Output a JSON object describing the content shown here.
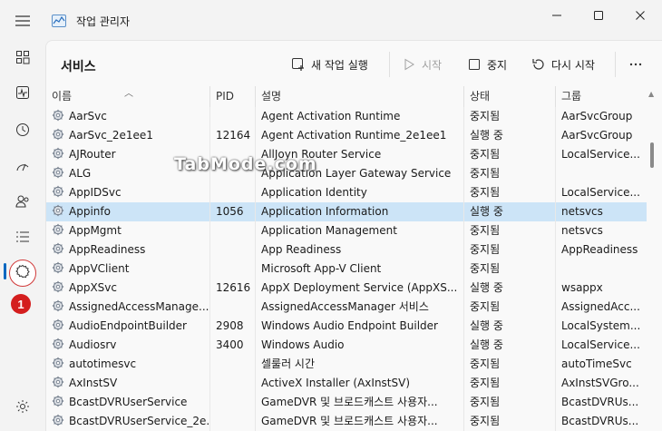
{
  "window": {
    "title": "작업 관리자"
  },
  "sidebar": {
    "items": [
      {
        "icon": "processes-icon"
      },
      {
        "icon": "performance-icon"
      },
      {
        "icon": "app-history-icon"
      },
      {
        "icon": "startup-apps-icon"
      },
      {
        "icon": "users-icon"
      },
      {
        "icon": "details-icon"
      },
      {
        "icon": "services-icon"
      }
    ],
    "badge": "1",
    "settings_icon": "settings-icon"
  },
  "header": {
    "title": "서비스",
    "new_task": "새 작업 실행",
    "start": "시작",
    "stop": "중지",
    "restart": "다시 시작"
  },
  "table": {
    "columns": {
      "name": "이름",
      "pid": "PID",
      "desc": "설명",
      "status": "상태",
      "group": "그룹"
    },
    "rows": [
      {
        "name": "AarSvc",
        "pid": "",
        "desc": "Agent Activation Runtime",
        "status": "중지됨",
        "group": "AarSvcGroup"
      },
      {
        "name": "AarSvc_2e1ee1",
        "pid": "12164",
        "desc": "Agent Activation Runtime_2e1ee1",
        "status": "실행 중",
        "group": "AarSvcGroup"
      },
      {
        "name": "AJRouter",
        "pid": "",
        "desc": "AllJoyn Router Service",
        "status": "중지됨",
        "group": "LocalService..."
      },
      {
        "name": "ALG",
        "pid": "",
        "desc": "Application Layer Gateway Service",
        "status": "중지됨",
        "group": ""
      },
      {
        "name": "AppIDSvc",
        "pid": "",
        "desc": "Application Identity",
        "status": "중지됨",
        "group": "LocalService..."
      },
      {
        "name": "Appinfo",
        "pid": "1056",
        "desc": "Application Information",
        "status": "실행 중",
        "group": "netsvcs"
      },
      {
        "name": "AppMgmt",
        "pid": "",
        "desc": "Application Management",
        "status": "중지됨",
        "group": "netsvcs"
      },
      {
        "name": "AppReadiness",
        "pid": "",
        "desc": "App Readiness",
        "status": "중지됨",
        "group": "AppReadiness"
      },
      {
        "name": "AppVClient",
        "pid": "",
        "desc": "Microsoft App-V Client",
        "status": "중지됨",
        "group": ""
      },
      {
        "name": "AppXSvc",
        "pid": "12616",
        "desc": "AppX Deployment Service (AppXS...",
        "status": "실행 중",
        "group": "wsappx"
      },
      {
        "name": "AssignedAccessManage...",
        "pid": "",
        "desc": "AssignedAccessManager 서비스",
        "status": "중지됨",
        "group": "AssignedAcc..."
      },
      {
        "name": "AudioEndpointBuilder",
        "pid": "2908",
        "desc": "Windows Audio Endpoint Builder",
        "status": "실행 중",
        "group": "LocalSystem..."
      },
      {
        "name": "Audiosrv",
        "pid": "3400",
        "desc": "Windows Audio",
        "status": "실행 중",
        "group": "LocalService..."
      },
      {
        "name": "autotimesvc",
        "pid": "",
        "desc": "셀룰러 시간",
        "status": "중지됨",
        "group": "autoTimeSvc"
      },
      {
        "name": "AxInstSV",
        "pid": "",
        "desc": "ActiveX Installer (AxInstSV)",
        "status": "중지됨",
        "group": "AxInstSVGro..."
      },
      {
        "name": "BcastDVRUserService",
        "pid": "",
        "desc": "GameDVR 및 브로드캐스트 사용자...",
        "status": "중지됨",
        "group": "BcastDVRUs..."
      },
      {
        "name": "BcastDVRUserService_2e...",
        "pid": "",
        "desc": "GameDVR 및 브로드캐스트 사용자...",
        "status": "중지됨",
        "group": "BcastDVRUs..."
      }
    ],
    "selected_index": 5
  },
  "watermark": "TabMode.com",
  "colors": {
    "selection": "#cce4f7",
    "accent": "#0067c0",
    "badge": "#d41e1e"
  }
}
